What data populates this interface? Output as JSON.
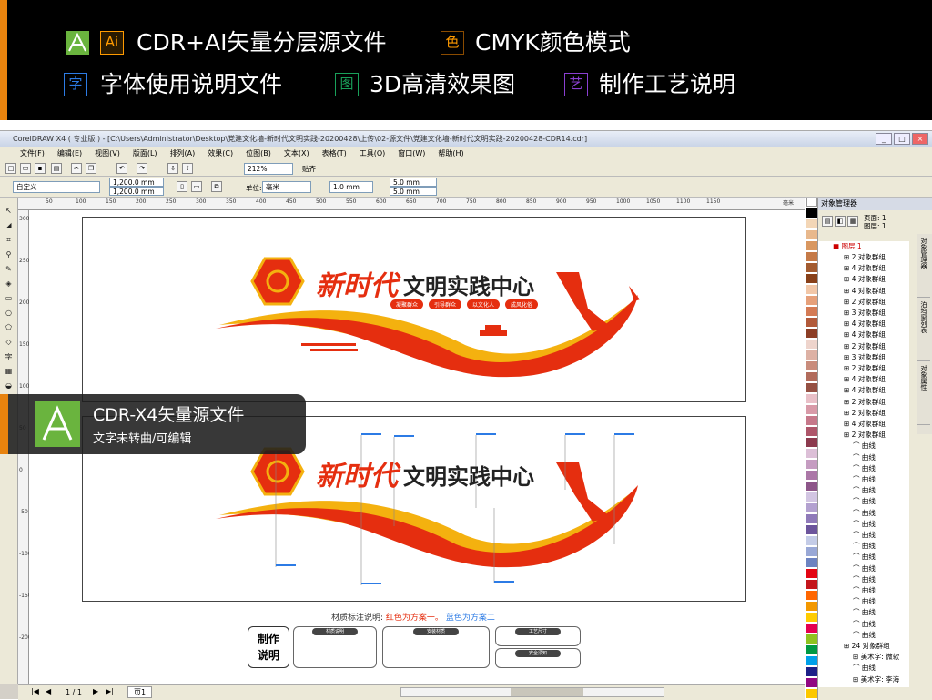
{
  "features": [
    {
      "icon": "Ai",
      "text": "CDR+AI矢量分层源文件"
    },
    {
      "icon": "色",
      "text": "CMYK颜色模式"
    },
    {
      "icon": "字",
      "text": "字体使用说明文件"
    },
    {
      "icon": "图",
      "text": "3D高清效果图"
    },
    {
      "icon": "艺",
      "text": "制作工艺说明"
    }
  ],
  "window": {
    "title": "CorelDRAW X4 ( 专业版 ) - [C:\\Users\\Administrator\\Desktop\\党建文化墙-新时代文明实践-20200428\\上传\\02-源文件\\党建文化墙-新时代文明实践-20200428-CDR14.cdr]"
  },
  "menu": [
    "文件(F)",
    "编辑(E)",
    "视图(V)",
    "版面(L)",
    "排列(A)",
    "效果(C)",
    "位图(B)",
    "文本(X)",
    "表格(T)",
    "工具(O)",
    "窗口(W)",
    "帮助(H)"
  ],
  "toolbar": {
    "zoom": "212%",
    "snap": "贴齐",
    "preset": "自定义",
    "width": "1,200.0 mm",
    "height": "1,200.0 mm",
    "unit_label": "单位:",
    "unit": "毫米",
    "nudge": "1.0 mm",
    "dup_x": "5.0 mm",
    "dup_y": "5.0 mm"
  },
  "ruler": [
    "50",
    "100",
    "150",
    "200",
    "250",
    "300",
    "350",
    "400",
    "450",
    "500",
    "550",
    "600",
    "650",
    "700",
    "750",
    "800",
    "850",
    "900",
    "950",
    "1000",
    "1050",
    "1100",
    "1150",
    "毫米"
  ],
  "vruler": [
    "300",
    "250",
    "200",
    "150",
    "100",
    "50",
    "0",
    "-50",
    "-100",
    "-150",
    "-200"
  ],
  "design": {
    "title_a": "新时代",
    "title_b": "文明实践中心",
    "tags": [
      "凝聚群众",
      "引导群众",
      "以文化人",
      "成风化俗"
    ]
  },
  "badge": {
    "title": "CDR-X4矢量源文件",
    "subtitle": "文字未转曲/可编辑"
  },
  "legend": {
    "label": "材质标注说明:",
    "red": "红色为方案一。",
    "blue": "蓝色为方案二"
  },
  "craft": {
    "title": "制作\n说明",
    "cards": [
      "材质说明",
      "安装材质",
      "工艺尺寸",
      "安全须知"
    ]
  },
  "status": {
    "page": "1 / 1",
    "tab": "页1"
  },
  "docker": {
    "title": "对象管理器",
    "page": "页面: 1",
    "layer": "图层: 1",
    "layer_name": "图层 1",
    "tabs": [
      "对象管理器",
      "泊坞窗列表",
      "对象属性"
    ]
  },
  "tree": [
    "2 对象群组",
    "4 对象群组",
    "4 对象群组",
    "4 对象群组",
    "2 对象群组",
    "3 对象群组",
    "4 对象群组",
    "4 对象群组",
    "2 对象群组",
    "3 对象群组",
    "2 对象群组",
    "4 对象群组",
    "4 对象群组",
    "2 对象群组",
    "2 对象群组",
    "4 对象群组",
    "2 对象群组",
    "曲线",
    "曲线",
    "曲线",
    "曲线",
    "曲线",
    "曲线",
    "曲线",
    "曲线",
    "曲线",
    "曲线",
    "曲线",
    "曲线",
    "曲线",
    "曲线",
    "曲线",
    "曲线",
    "曲线",
    "曲线",
    "24 对象群组",
    "美术字: 微软",
    "曲线",
    "美术字: 李海"
  ],
  "palette": [
    "#ffffff",
    "#000000",
    "#f3d6b6",
    "#e8b88c",
    "#d99760",
    "#c57a48",
    "#a35b30",
    "#884019",
    "#f2c7a8",
    "#e6a07a",
    "#d47b55",
    "#b25a3a",
    "#8c3e26",
    "#eed4cc",
    "#ddb1a4",
    "#c98c7c",
    "#b26c5c",
    "#955043",
    "#e9c0c8",
    "#d89aa8",
    "#c6788a",
    "#ae566a",
    "#8c3a4e",
    "#dcbfd7",
    "#c59cc1",
    "#ab77a7",
    "#8d5689",
    "#d2c5e2",
    "#b3a1d0",
    "#8f7ab9",
    "#6c559c",
    "#c4cce7",
    "#99a8d6",
    "#6d83c1",
    "#e30613",
    "#c4161c",
    "#ff6600",
    "#f39800",
    "#ffcc00",
    "#e5004f",
    "#8fc31f",
    "#009944",
    "#00a0e9",
    "#1d2088",
    "#920783",
    "#fcc800"
  ],
  "colors": {
    "brand_orange": "#e8830e",
    "red": "#e52e0f",
    "yellow": "#f4b10f",
    "green": "#6ab43e",
    "blue": "#2c7be5"
  }
}
